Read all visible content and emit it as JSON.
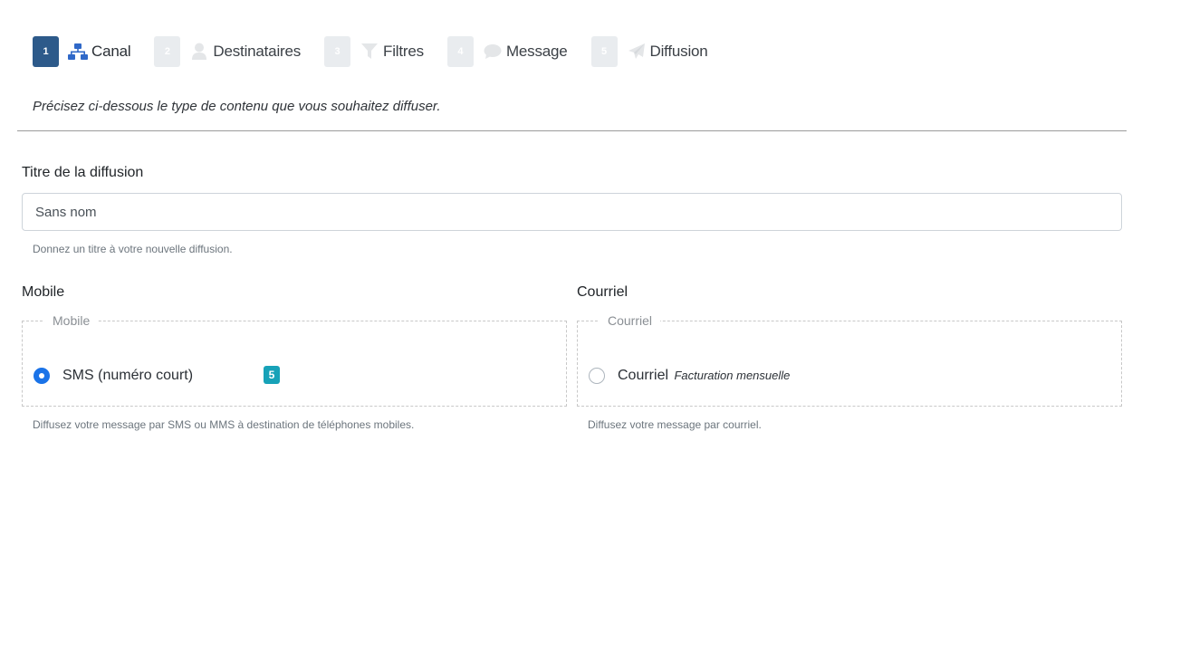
{
  "steps": [
    {
      "num": "1",
      "label": "Canal",
      "icon": "sitemap-icon"
    },
    {
      "num": "2",
      "label": "Destinataires",
      "icon": "user-icon"
    },
    {
      "num": "3",
      "label": "Filtres",
      "icon": "filter-icon"
    },
    {
      "num": "4",
      "label": "Message",
      "icon": "comment-icon"
    },
    {
      "num": "5",
      "label": "Diffusion",
      "icon": "paper-plane-icon"
    }
  ],
  "active_step": "1",
  "intro": "Précisez ci-dessous le type de contenu que vous souhaitez diffuser.",
  "title_field": {
    "label": "Titre de la diffusion",
    "value": "Sans nom",
    "help": "Donnez un titre à votre nouvelle diffusion."
  },
  "mobile": {
    "heading": "Mobile",
    "legend": "Mobile",
    "option_label": "SMS (numéro court)",
    "selected": true,
    "badge": "5",
    "help": "Diffusez votre message par SMS ou MMS à destination de téléphones mobiles."
  },
  "courriel": {
    "heading": "Courriel",
    "legend": "Courriel",
    "option_label": "Courriel",
    "option_sub": "Facturation mensuelle",
    "selected": false,
    "help": "Diffusez votre message par courriel."
  },
  "colors": {
    "active_step": "#2d5a8a",
    "inactive_step": "#e9ecef",
    "radio_checked": "#1a73e8",
    "badge": "#17a2b8",
    "icon_active": "#2f68c8",
    "icon_inactive": "#e4e6e8"
  }
}
